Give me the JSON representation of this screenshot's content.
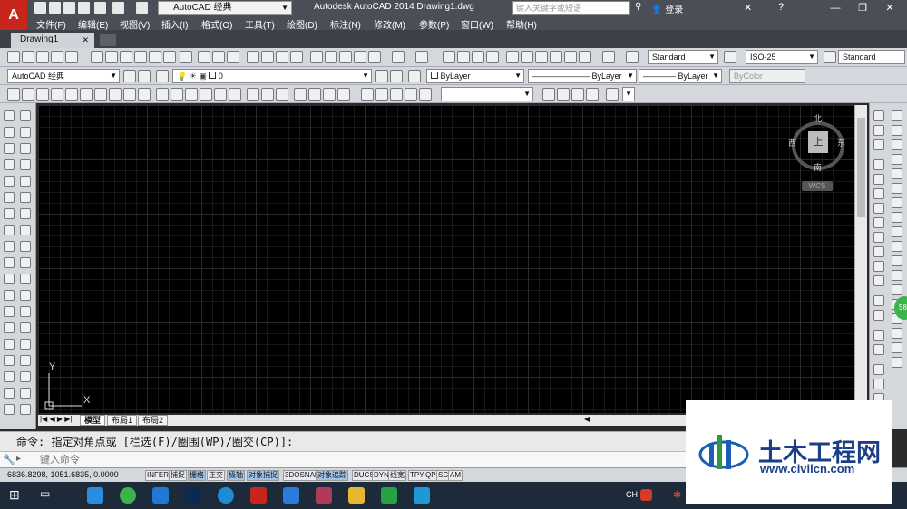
{
  "window": {
    "workspace": "AutoCAD 经典",
    "title": "Autodesk AutoCAD 2014    Drawing1.dwg",
    "search_placeholder": "键入关键字或短语",
    "login": "登录"
  },
  "menu": [
    "文件(F)",
    "编辑(E)",
    "视图(V)",
    "插入(I)",
    "格式(O)",
    "工具(T)",
    "绘图(D)",
    "标注(N)",
    "修改(M)",
    "参数(P)",
    "窗口(W)",
    "帮助(H)"
  ],
  "tabs": {
    "drawing": "Drawing1"
  },
  "toolbars": {
    "text_style": "Standard",
    "dim_style": "ISO-25",
    "table_style": "Standard",
    "workspace_combo": "AutoCAD 经典",
    "layer": "0",
    "color": "ByLayer",
    "linetype": "ByLayer",
    "lineweight": "ByLayer",
    "plotstyle": "ByColor"
  },
  "viewcube": {
    "north": "北",
    "south": "南",
    "east": "东",
    "west": "西",
    "face": "上",
    "wcs": "WCS"
  },
  "ucs": {
    "y": "Y",
    "x": "X"
  },
  "layout_tabs": [
    "模型",
    "布局1",
    "布局2"
  ],
  "command": {
    "history": "命令: 指定对角点或 [栏选(F)/圈围(WP)/圈交(CP)]:",
    "input_placeholder": "键入命令"
  },
  "status": {
    "coords": "6836.8298, 1051.6835, 0.0000",
    "buttons": [
      "INFER",
      "捕捉",
      "栅格",
      "正交",
      "极轴",
      "对象捕捉",
      "3DOSNAP",
      "对象追踪",
      "DUCS",
      "DYN",
      "线宽",
      "TPY",
      "QP",
      "SC",
      "AM"
    ]
  },
  "taskbar": {
    "lang": "CH"
  },
  "watermark": {
    "title": "土木工程网",
    "url": "www.civilcn.com"
  },
  "bubble": "58"
}
